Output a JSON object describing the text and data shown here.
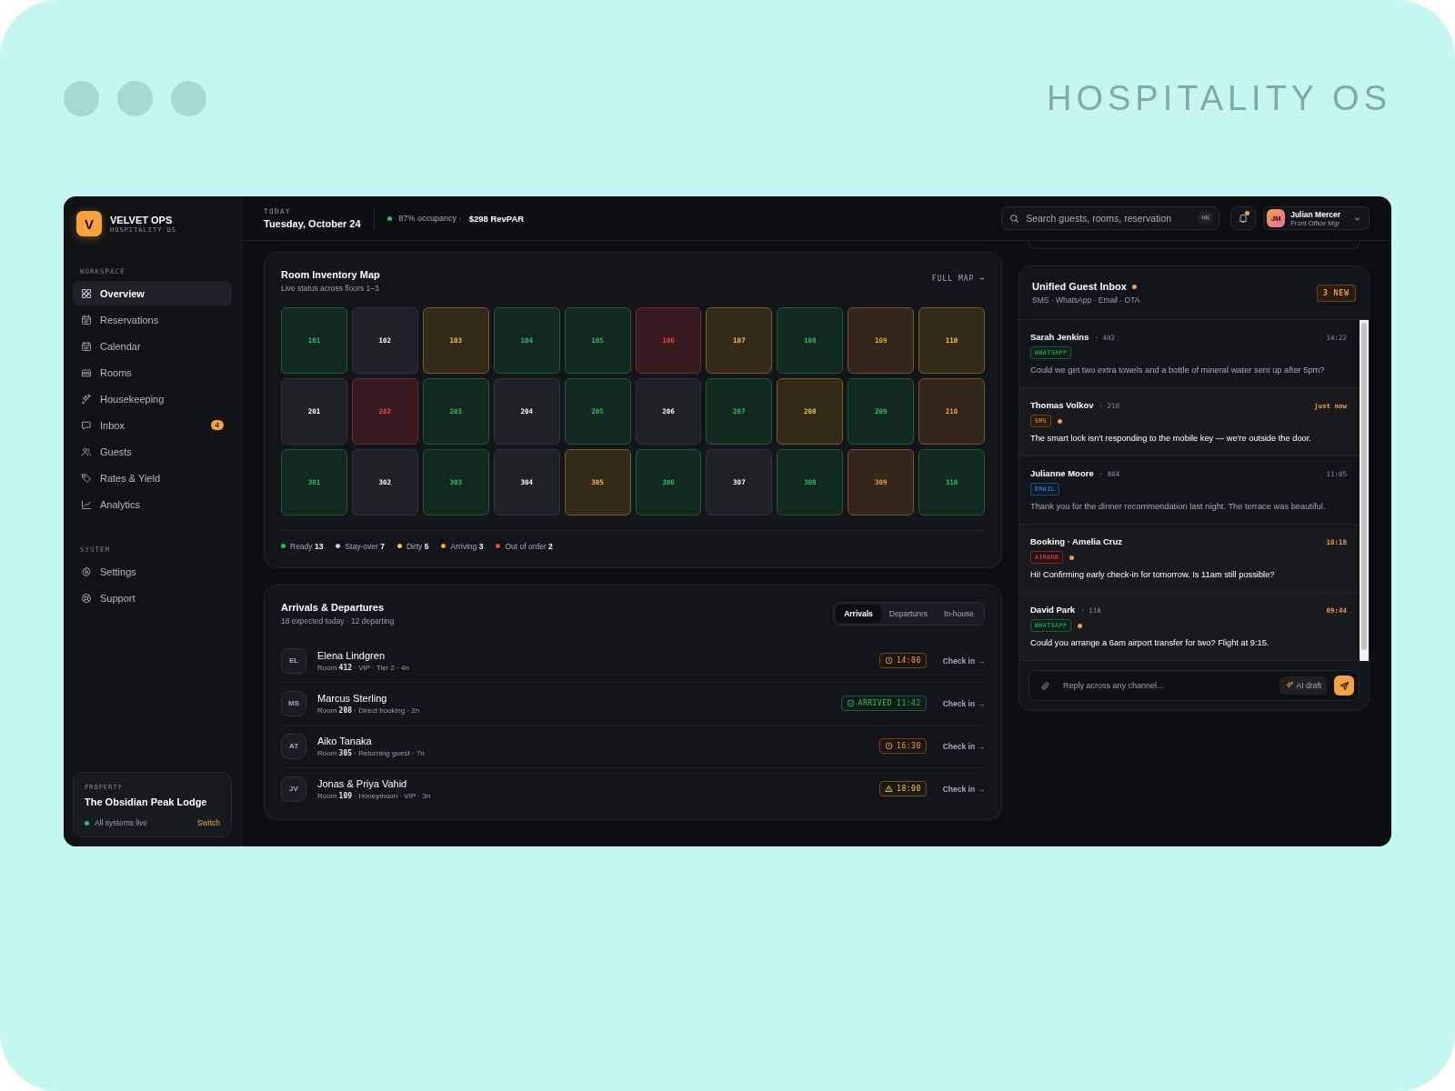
{
  "frame": {
    "title": "HOSPITALITY OS"
  },
  "sidebar": {
    "brand": {
      "logo": "V",
      "name": "VELVET OPS",
      "tagline": "HOSPITALITY OS"
    },
    "sections": [
      {
        "label": "WORKSPACE",
        "items": [
          {
            "label": "Overview",
            "selected": true
          },
          {
            "label": "Reservations",
            "selected": false
          },
          {
            "label": "Calendar",
            "selected": false
          },
          {
            "label": "Rooms",
            "selected": false
          },
          {
            "label": "Housekeeping",
            "selected": false
          },
          {
            "label": "Inbox",
            "selected": false,
            "badge": "4"
          },
          {
            "label": "Guests",
            "selected": false
          },
          {
            "label": "Rates & Yield",
            "selected": false
          },
          {
            "label": "Analytics",
            "selected": false
          }
        ]
      },
      {
        "label": "SYSTEM",
        "items": [
          {
            "label": "Settings",
            "selected": false
          },
          {
            "label": "Support",
            "selected": false
          }
        ]
      }
    ],
    "property": {
      "label": "PROPERTY",
      "name": "The Obsidian Peak Lodge",
      "status": "All systems live",
      "action": "Switch"
    }
  },
  "topbar": {
    "day_label": "TODAY",
    "date": "Tuesday, October 24",
    "occupancy": "87% occupancy ·",
    "revpar": "$298 RevPAR",
    "search": {
      "placeholder": "Search guests, rooms, reservation",
      "shortcut": "⌘K"
    },
    "notifications_unread": true,
    "user": {
      "initials": "JM",
      "name": "Julian Mercer",
      "role": "Front Office Mgr"
    }
  },
  "room_map": {
    "title": "Room Inventory Map",
    "subtitle": "Live status across floors 1–3",
    "link": "FULL MAP →",
    "rooms": [
      {
        "number": "101",
        "kind": "ready"
      },
      {
        "number": "102",
        "kind": "stayover"
      },
      {
        "number": "103",
        "kind": "dirty"
      },
      {
        "number": "104",
        "kind": "ready"
      },
      {
        "number": "105",
        "kind": "ready"
      },
      {
        "number": "106",
        "kind": "outoforder"
      },
      {
        "number": "107",
        "kind": "dirty"
      },
      {
        "number": "108",
        "kind": "ready"
      },
      {
        "number": "109",
        "kind": "arriving"
      },
      {
        "number": "110",
        "kind": "dirty"
      },
      {
        "number": "201",
        "kind": "stayover"
      },
      {
        "number": "202",
        "kind": "outoforder"
      },
      {
        "number": "203",
        "kind": "ready"
      },
      {
        "number": "204",
        "kind": "stayover"
      },
      {
        "number": "205",
        "kind": "ready"
      },
      {
        "number": "206",
        "kind": "stayover"
      },
      {
        "number": "207",
        "kind": "ready"
      },
      {
        "number": "208",
        "kind": "dirty"
      },
      {
        "number": "209",
        "kind": "ready"
      },
      {
        "number": "210",
        "kind": "arriving"
      },
      {
        "number": "301",
        "kind": "ready"
      },
      {
        "number": "302",
        "kind": "stayover"
      },
      {
        "number": "303",
        "kind": "ready"
      },
      {
        "number": "304",
        "kind": "stayover"
      },
      {
        "number": "305",
        "kind": "dirty"
      },
      {
        "number": "306",
        "kind": "ready"
      },
      {
        "number": "307",
        "kind": "stayover"
      },
      {
        "number": "308",
        "kind": "ready"
      },
      {
        "number": "309",
        "kind": "arriving"
      },
      {
        "number": "310",
        "kind": "ready"
      }
    ],
    "legend": [
      {
        "label": "Ready",
        "count": "13",
        "color": "#22c55e"
      },
      {
        "label": "Stay-over",
        "count": "7",
        "color": "#c8ccd2"
      },
      {
        "label": "Dirty",
        "count": "5",
        "color": "#f5c242"
      },
      {
        "label": "Arriving",
        "count": "3",
        "color": "#f59e3a"
      },
      {
        "label": "Out of order",
        "count": "2",
        "color": "#ef4444"
      }
    ]
  },
  "arrivals": {
    "title": "Arrivals & Departures",
    "subtitle": "18 expected today · 12 departing",
    "tabs": [
      {
        "label": "Arrivals",
        "selected": true
      },
      {
        "label": "Departures",
        "selected": false
      },
      {
        "label": "In-house",
        "selected": false
      }
    ],
    "guests": [
      {
        "initials": "EL",
        "name": "Elena Lindgren",
        "meta": "Room **412** · VIP · Tier 2 · 4n",
        "badge": {
          "kind": "time",
          "text": "14:00"
        },
        "action": "Check in →"
      },
      {
        "initials": "MS",
        "name": "Marcus Sterling",
        "meta": "Room **208** · Direct booking · 2n",
        "badge": {
          "kind": "arrived",
          "text": "ARRIVED 11:42"
        },
        "action": "Check in →"
      },
      {
        "initials": "AT",
        "name": "Aiko Tanaka",
        "meta": "Room **305** · Returning guest · 7n",
        "badge": {
          "kind": "time",
          "text": "16:30"
        },
        "action": "Check in →"
      },
      {
        "initials": "JV",
        "name": "Jonas & Priya Vahid",
        "meta": "Room **109** · Honeymoon · VIP · 3n",
        "badge": {
          "kind": "warning",
          "text": "18:00"
        },
        "action": "Check in →"
      }
    ]
  },
  "inbox": {
    "title": "Unified Guest Inbox",
    "live": true,
    "subtitle": "SMS · WhatsApp · Email · OTA",
    "new_count": "3 NEW",
    "messages": [
      {
        "name": "Sarah Jenkins",
        "room": "· 402",
        "time": "14:22",
        "channel": {
          "kind": "whatsapp",
          "label": "WHATSAPP"
        },
        "unread": false,
        "text": "Could we get two extra towels and a bottle of mineral water sent up after 5pm?"
      },
      {
        "name": "Thomas Volkov",
        "room": "· 210",
        "time": "just now",
        "channel": {
          "kind": "sms",
          "label": "SMS"
        },
        "unread": true,
        "text": "The smart lock isn't responding to the mobile key — we're outside the door."
      },
      {
        "name": "Julianne Moore",
        "room": "· 804",
        "time": "11:05",
        "channel": {
          "kind": "email",
          "label": "EMAIL"
        },
        "unread": false,
        "text": "Thank you for the dinner recommendation last night. The terrace was beautiful."
      },
      {
        "name": "Booking · Amelia Cruz",
        "time": "10:18",
        "channel": {
          "kind": "airbnb",
          "label": "AIRBNB"
        },
        "unread": true,
        "text": "Hi! Confirming early check-in for tomorrow. Is 11am still possible?"
      },
      {
        "name": "David Park",
        "room": "· 118",
        "time": "09:44",
        "channel": {
          "kind": "whatsapp",
          "label": "WHATSAPP"
        },
        "unread": true,
        "text": "Could you arrange a 6am airport transfer for two? Flight at 9:15."
      }
    ],
    "reply": {
      "placeholder": "Reply across any channel...",
      "ai_button": "AI draft"
    }
  }
}
